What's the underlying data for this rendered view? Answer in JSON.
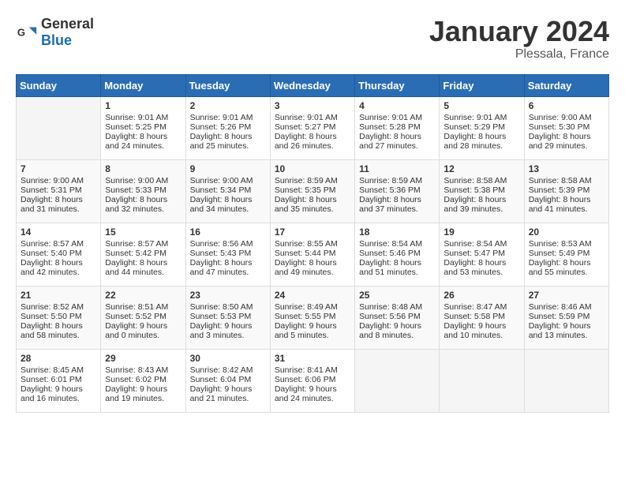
{
  "header": {
    "logo_general": "General",
    "logo_blue": "Blue",
    "title": "January 2024",
    "location": "Plessala, France"
  },
  "calendar": {
    "days_of_week": [
      "Sunday",
      "Monday",
      "Tuesday",
      "Wednesday",
      "Thursday",
      "Friday",
      "Saturday"
    ],
    "weeks": [
      [
        {
          "day": "",
          "empty": true
        },
        {
          "day": "1",
          "sunrise": "9:01 AM",
          "sunset": "5:25 PM",
          "daylight": "8 hours and 24 minutes."
        },
        {
          "day": "2",
          "sunrise": "9:01 AM",
          "sunset": "5:26 PM",
          "daylight": "8 hours and 25 minutes."
        },
        {
          "day": "3",
          "sunrise": "9:01 AM",
          "sunset": "5:27 PM",
          "daylight": "8 hours and 26 minutes."
        },
        {
          "day": "4",
          "sunrise": "9:01 AM",
          "sunset": "5:28 PM",
          "daylight": "8 hours and 27 minutes."
        },
        {
          "day": "5",
          "sunrise": "9:01 AM",
          "sunset": "5:29 PM",
          "daylight": "8 hours and 28 minutes."
        },
        {
          "day": "6",
          "sunrise": "9:00 AM",
          "sunset": "5:30 PM",
          "daylight": "8 hours and 29 minutes."
        }
      ],
      [
        {
          "day": "7",
          "sunrise": "9:00 AM",
          "sunset": "5:31 PM",
          "daylight": "8 hours and 31 minutes."
        },
        {
          "day": "8",
          "sunrise": "9:00 AM",
          "sunset": "5:33 PM",
          "daylight": "8 hours and 32 minutes."
        },
        {
          "day": "9",
          "sunrise": "9:00 AM",
          "sunset": "5:34 PM",
          "daylight": "8 hours and 34 minutes."
        },
        {
          "day": "10",
          "sunrise": "8:59 AM",
          "sunset": "5:35 PM",
          "daylight": "8 hours and 35 minutes."
        },
        {
          "day": "11",
          "sunrise": "8:59 AM",
          "sunset": "5:36 PM",
          "daylight": "8 hours and 37 minutes."
        },
        {
          "day": "12",
          "sunrise": "8:58 AM",
          "sunset": "5:38 PM",
          "daylight": "8 hours and 39 minutes."
        },
        {
          "day": "13",
          "sunrise": "8:58 AM",
          "sunset": "5:39 PM",
          "daylight": "8 hours and 41 minutes."
        }
      ],
      [
        {
          "day": "14",
          "sunrise": "8:57 AM",
          "sunset": "5:40 PM",
          "daylight": "8 hours and 42 minutes."
        },
        {
          "day": "15",
          "sunrise": "8:57 AM",
          "sunset": "5:42 PM",
          "daylight": "8 hours and 44 minutes."
        },
        {
          "day": "16",
          "sunrise": "8:56 AM",
          "sunset": "5:43 PM",
          "daylight": "8 hours and 47 minutes."
        },
        {
          "day": "17",
          "sunrise": "8:55 AM",
          "sunset": "5:44 PM",
          "daylight": "8 hours and 49 minutes."
        },
        {
          "day": "18",
          "sunrise": "8:54 AM",
          "sunset": "5:46 PM",
          "daylight": "8 hours and 51 minutes."
        },
        {
          "day": "19",
          "sunrise": "8:54 AM",
          "sunset": "5:47 PM",
          "daylight": "8 hours and 53 minutes."
        },
        {
          "day": "20",
          "sunrise": "8:53 AM",
          "sunset": "5:49 PM",
          "daylight": "8 hours and 55 minutes."
        }
      ],
      [
        {
          "day": "21",
          "sunrise": "8:52 AM",
          "sunset": "5:50 PM",
          "daylight": "8 hours and 58 minutes."
        },
        {
          "day": "22",
          "sunrise": "8:51 AM",
          "sunset": "5:52 PM",
          "daylight": "9 hours and 0 minutes."
        },
        {
          "day": "23",
          "sunrise": "8:50 AM",
          "sunset": "5:53 PM",
          "daylight": "9 hours and 3 minutes."
        },
        {
          "day": "24",
          "sunrise": "8:49 AM",
          "sunset": "5:55 PM",
          "daylight": "9 hours and 5 minutes."
        },
        {
          "day": "25",
          "sunrise": "8:48 AM",
          "sunset": "5:56 PM",
          "daylight": "9 hours and 8 minutes."
        },
        {
          "day": "26",
          "sunrise": "8:47 AM",
          "sunset": "5:58 PM",
          "daylight": "9 hours and 10 minutes."
        },
        {
          "day": "27",
          "sunrise": "8:46 AM",
          "sunset": "5:59 PM",
          "daylight": "9 hours and 13 minutes."
        }
      ],
      [
        {
          "day": "28",
          "sunrise": "8:45 AM",
          "sunset": "6:01 PM",
          "daylight": "9 hours and 16 minutes."
        },
        {
          "day": "29",
          "sunrise": "8:43 AM",
          "sunset": "6:02 PM",
          "daylight": "9 hours and 19 minutes."
        },
        {
          "day": "30",
          "sunrise": "8:42 AM",
          "sunset": "6:04 PM",
          "daylight": "9 hours and 21 minutes."
        },
        {
          "day": "31",
          "sunrise": "8:41 AM",
          "sunset": "6:06 PM",
          "daylight": "9 hours and 24 minutes."
        },
        {
          "day": "",
          "empty": true
        },
        {
          "day": "",
          "empty": true
        },
        {
          "day": "",
          "empty": true
        }
      ]
    ]
  }
}
